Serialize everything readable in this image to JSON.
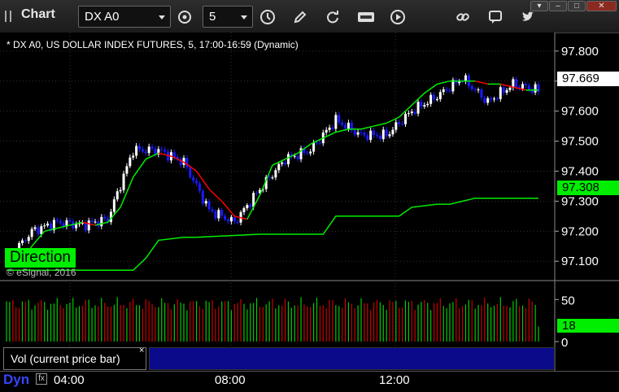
{
  "window": {
    "title": "Chart"
  },
  "toolbar": {
    "symbol_value": "DX A0",
    "interval_value": "5",
    "icons": [
      "bar-settings-icon",
      "clock-icon",
      "pencil-icon",
      "refresh-icon",
      "get-icon",
      "play-icon",
      "link-icon",
      "comment-icon",
      "twitter-icon"
    ]
  },
  "window_controls": {
    "options": "▾",
    "minimize": "–",
    "maximize": "□",
    "close": "✕"
  },
  "chart": {
    "legend": "* DX A0, US DOLLAR INDEX FUTURES, 5, 17:00-16:59 (Dynamic)",
    "watermark": "© eSignal, 2016",
    "direction_label": "Direction",
    "last_price_tag": "97.669",
    "study_price_tag": "97.308",
    "price_axis": [
      "97.800",
      "97.700",
      "97.600",
      "97.500",
      "97.400",
      "97.300",
      "97.200",
      "97.100"
    ],
    "time_axis": [
      "04:00",
      "08:00",
      "12:00"
    ],
    "colors": {
      "up": "#ffffff",
      "down": "#1a1aff",
      "fast_ma_up": "#00ee00",
      "fast_ma_down": "#ff0000",
      "slow_line": "#00ee00",
      "vol_up": "#00cc00",
      "vol_down": "#cc0000"
    }
  },
  "volume": {
    "label": "Vol (current price bar)",
    "close_glyph": "×",
    "axis": [
      "50",
      "0"
    ],
    "current_tag": "18"
  },
  "status": {
    "dyn_label": "Dyn",
    "dyn_icon": "fx"
  },
  "chart_data": {
    "type": "line",
    "title": "* DX A0, US DOLLAR INDEX FUTURES, 5, 17:00-16:59 (Dynamic)",
    "x_ticks": [
      "04:00",
      "08:00",
      "12:00"
    ],
    "y_ticks": [
      97.8,
      97.7,
      97.6,
      97.5,
      97.4,
      97.3,
      97.2,
      97.1
    ],
    "ylim": [
      97.06,
      97.84
    ],
    "grid": true,
    "series": [
      {
        "name": "DX A0",
        "x": [
          0,
          8,
          16,
          24,
          32,
          40,
          48,
          56,
          64,
          72,
          80,
          88,
          96,
          104,
          112,
          120,
          128,
          136,
          144,
          152,
          160,
          168
        ],
        "y": [
          97.1,
          97.2,
          97.23,
          97.22,
          97.24,
          97.47,
          97.47,
          97.43,
          97.27,
          97.23,
          97.34,
          97.44,
          97.47,
          97.57,
          97.52,
          97.52,
          97.6,
          97.65,
          97.71,
          97.63,
          97.69,
          97.669
        ]
      },
      {
        "name": "Direction",
        "x": [
          0,
          4,
          8,
          12,
          16,
          20,
          24,
          28,
          32,
          36,
          40,
          44,
          48,
          52,
          56,
          60,
          64,
          68,
          72,
          76,
          80,
          84,
          88,
          92,
          96,
          100,
          104,
          108,
          112,
          116,
          120,
          124,
          128,
          132,
          136,
          140,
          144,
          148,
          152,
          156,
          160,
          164,
          168
        ],
        "y": [
          97.08,
          97.09,
          97.15,
          97.2,
          97.21,
          97.22,
          97.23,
          97.22,
          97.23,
          97.28,
          97.38,
          97.44,
          97.46,
          97.45,
          97.43,
          97.4,
          97.34,
          97.3,
          97.25,
          97.24,
          97.32,
          97.42,
          97.44,
          97.46,
          97.49,
          97.51,
          97.53,
          97.54,
          97.54,
          97.55,
          97.56,
          97.58,
          97.62,
          97.66,
          97.69,
          97.7,
          97.7,
          97.7,
          97.69,
          97.69,
          97.68,
          97.67,
          97.67
        ]
      },
      {
        "name": "",
        "x": [
          0,
          40,
          44,
          48,
          56,
          60,
          80,
          100,
          104,
          112,
          124,
          128,
          136,
          140,
          144,
          148,
          152,
          156,
          168
        ],
        "y": [
          97.07,
          97.07,
          97.11,
          97.17,
          97.18,
          97.18,
          97.19,
          97.19,
          97.25,
          97.25,
          97.25,
          97.28,
          97.29,
          97.29,
          97.3,
          97.31,
          97.31,
          97.31,
          97.31
        ]
      }
    ],
    "volume_range": [
      0,
      60
    ]
  }
}
